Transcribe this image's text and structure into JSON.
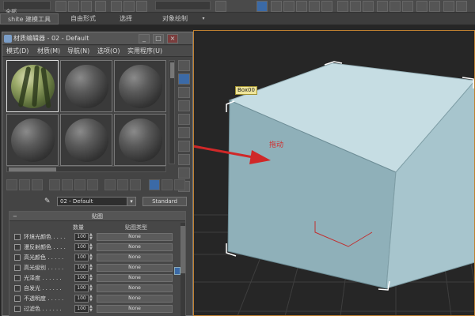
{
  "toolbar": {
    "selection_text": "全部",
    "colors": {
      "accent": "#3b6aa7"
    }
  },
  "ribbon": {
    "tabs": [
      {
        "label": "shite 建模工具"
      },
      {
        "label": "自由形式"
      },
      {
        "label": "选择"
      },
      {
        "label": "对象绘制"
      }
    ]
  },
  "viewport": {
    "object_label": "Box00",
    "annotation_text": "拖动"
  },
  "material_editor": {
    "title": "材质编辑器 - 02 - Default",
    "window_buttons": [
      "_",
      "□",
      "×"
    ],
    "menus": [
      {
        "label": "模式(D)"
      },
      {
        "label": "材质(M)"
      },
      {
        "label": "导航(N)"
      },
      {
        "label": "选项(O)"
      },
      {
        "label": "实用程序(U)"
      }
    ],
    "material_name": "02 - Default",
    "material_type": "Standard",
    "maps_rollout": {
      "title": "贴图",
      "columns": {
        "amount": "数量",
        "map_type": "贴图类型"
      },
      "rows": [
        {
          "name": "环境光颜色 . . . .",
          "amount": "100",
          "map": "None"
        },
        {
          "name": "漫反射颜色 . . . .",
          "amount": "100",
          "map": "None"
        },
        {
          "name": "高光颜色 . . . . .",
          "amount": "100",
          "map": "None"
        },
        {
          "name": "高光级别 . . . . .",
          "amount": "100",
          "map": "None"
        },
        {
          "name": "光泽度 . . . . . .",
          "amount": "100",
          "map": "None"
        },
        {
          "name": "自发光 . . . . . .",
          "amount": "100",
          "map": "None"
        },
        {
          "name": "不透明度 . . . . .",
          "amount": "100",
          "map": "None"
        },
        {
          "name": "过滤色 . . . . . .",
          "amount": "100",
          "map": "None"
        }
      ]
    }
  }
}
